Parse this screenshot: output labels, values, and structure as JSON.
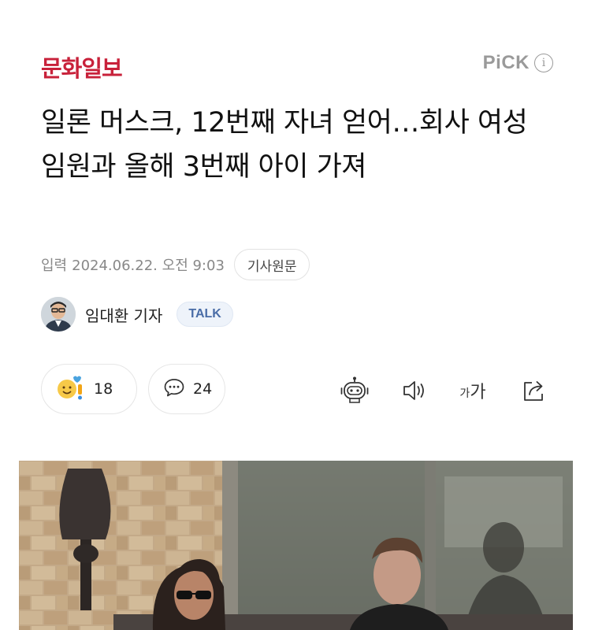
{
  "header": {
    "press_name": "문화일보",
    "pick_label": "PiCK",
    "info_glyph": "i"
  },
  "article": {
    "headline": "일론 머스크, 12번째 자녀 얻어…회사 여성 임원과 올해 3번째 아이 가져",
    "date_label": "입력",
    "date": "2024.06.22. 오전 9:03",
    "source_button": "기사원문"
  },
  "reporter": {
    "name": "임대환 기자",
    "talk_label": "TALK"
  },
  "actions": {
    "reaction_count": "18",
    "comment_count": "24",
    "font_size_label_small": "가",
    "font_size_label_large": "가",
    "icons": [
      "reaction-emoji-icon",
      "comment-bubble-icon",
      "robot-summary-icon",
      "speaker-icon",
      "font-size-icon",
      "share-icon"
    ]
  },
  "photo": {
    "description_icon": "article-photo"
  },
  "colors": {
    "press_red": "#c8213a",
    "muted_gray": "#888888",
    "talk_blue": "#4a6da7"
  }
}
